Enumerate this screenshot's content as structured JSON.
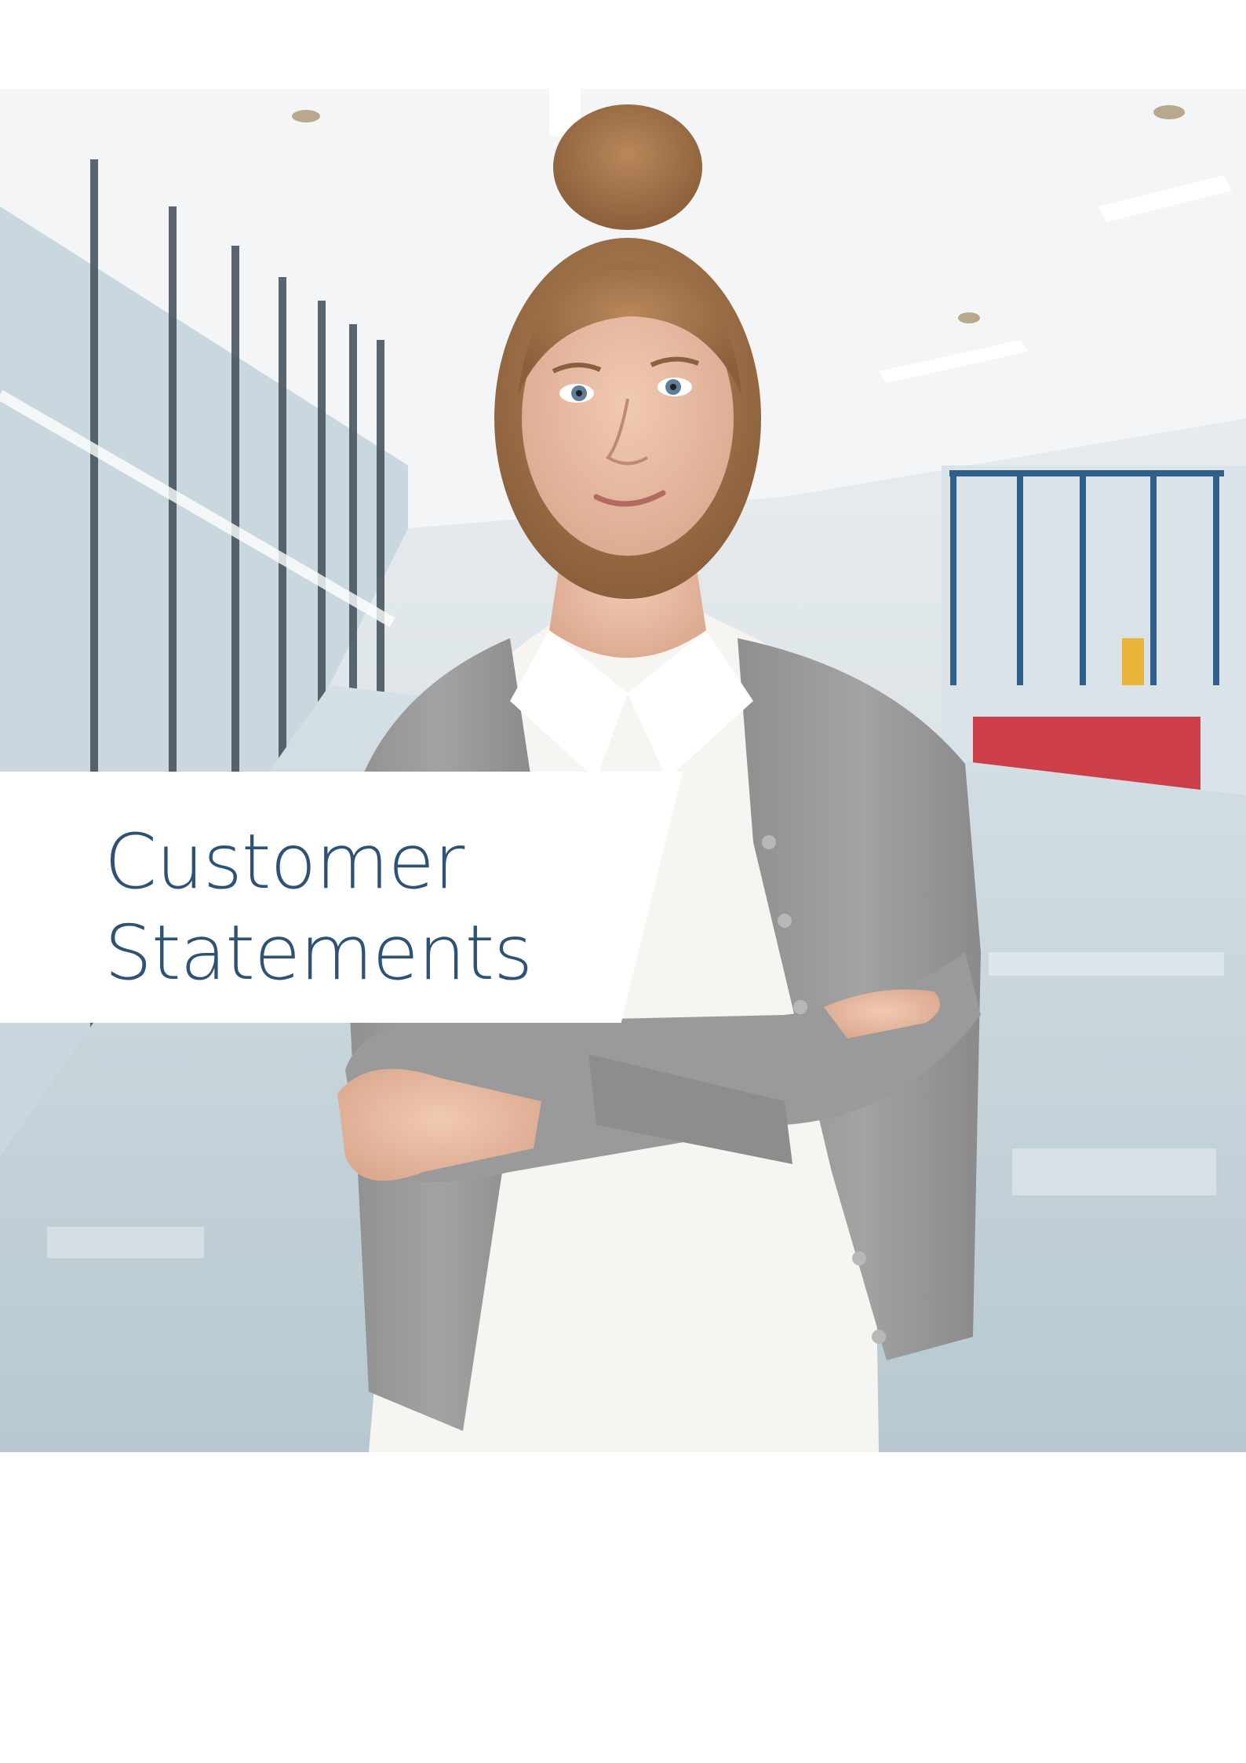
{
  "cover": {
    "title_line1": "Customer",
    "title_line2": "Statements"
  },
  "colors": {
    "title_text": "#2e5275",
    "panel_background": "#ffffff",
    "page_background": "#ffffff"
  },
  "photo": {
    "subject": "woman-with-crossed-arms-in-office-corridor"
  }
}
